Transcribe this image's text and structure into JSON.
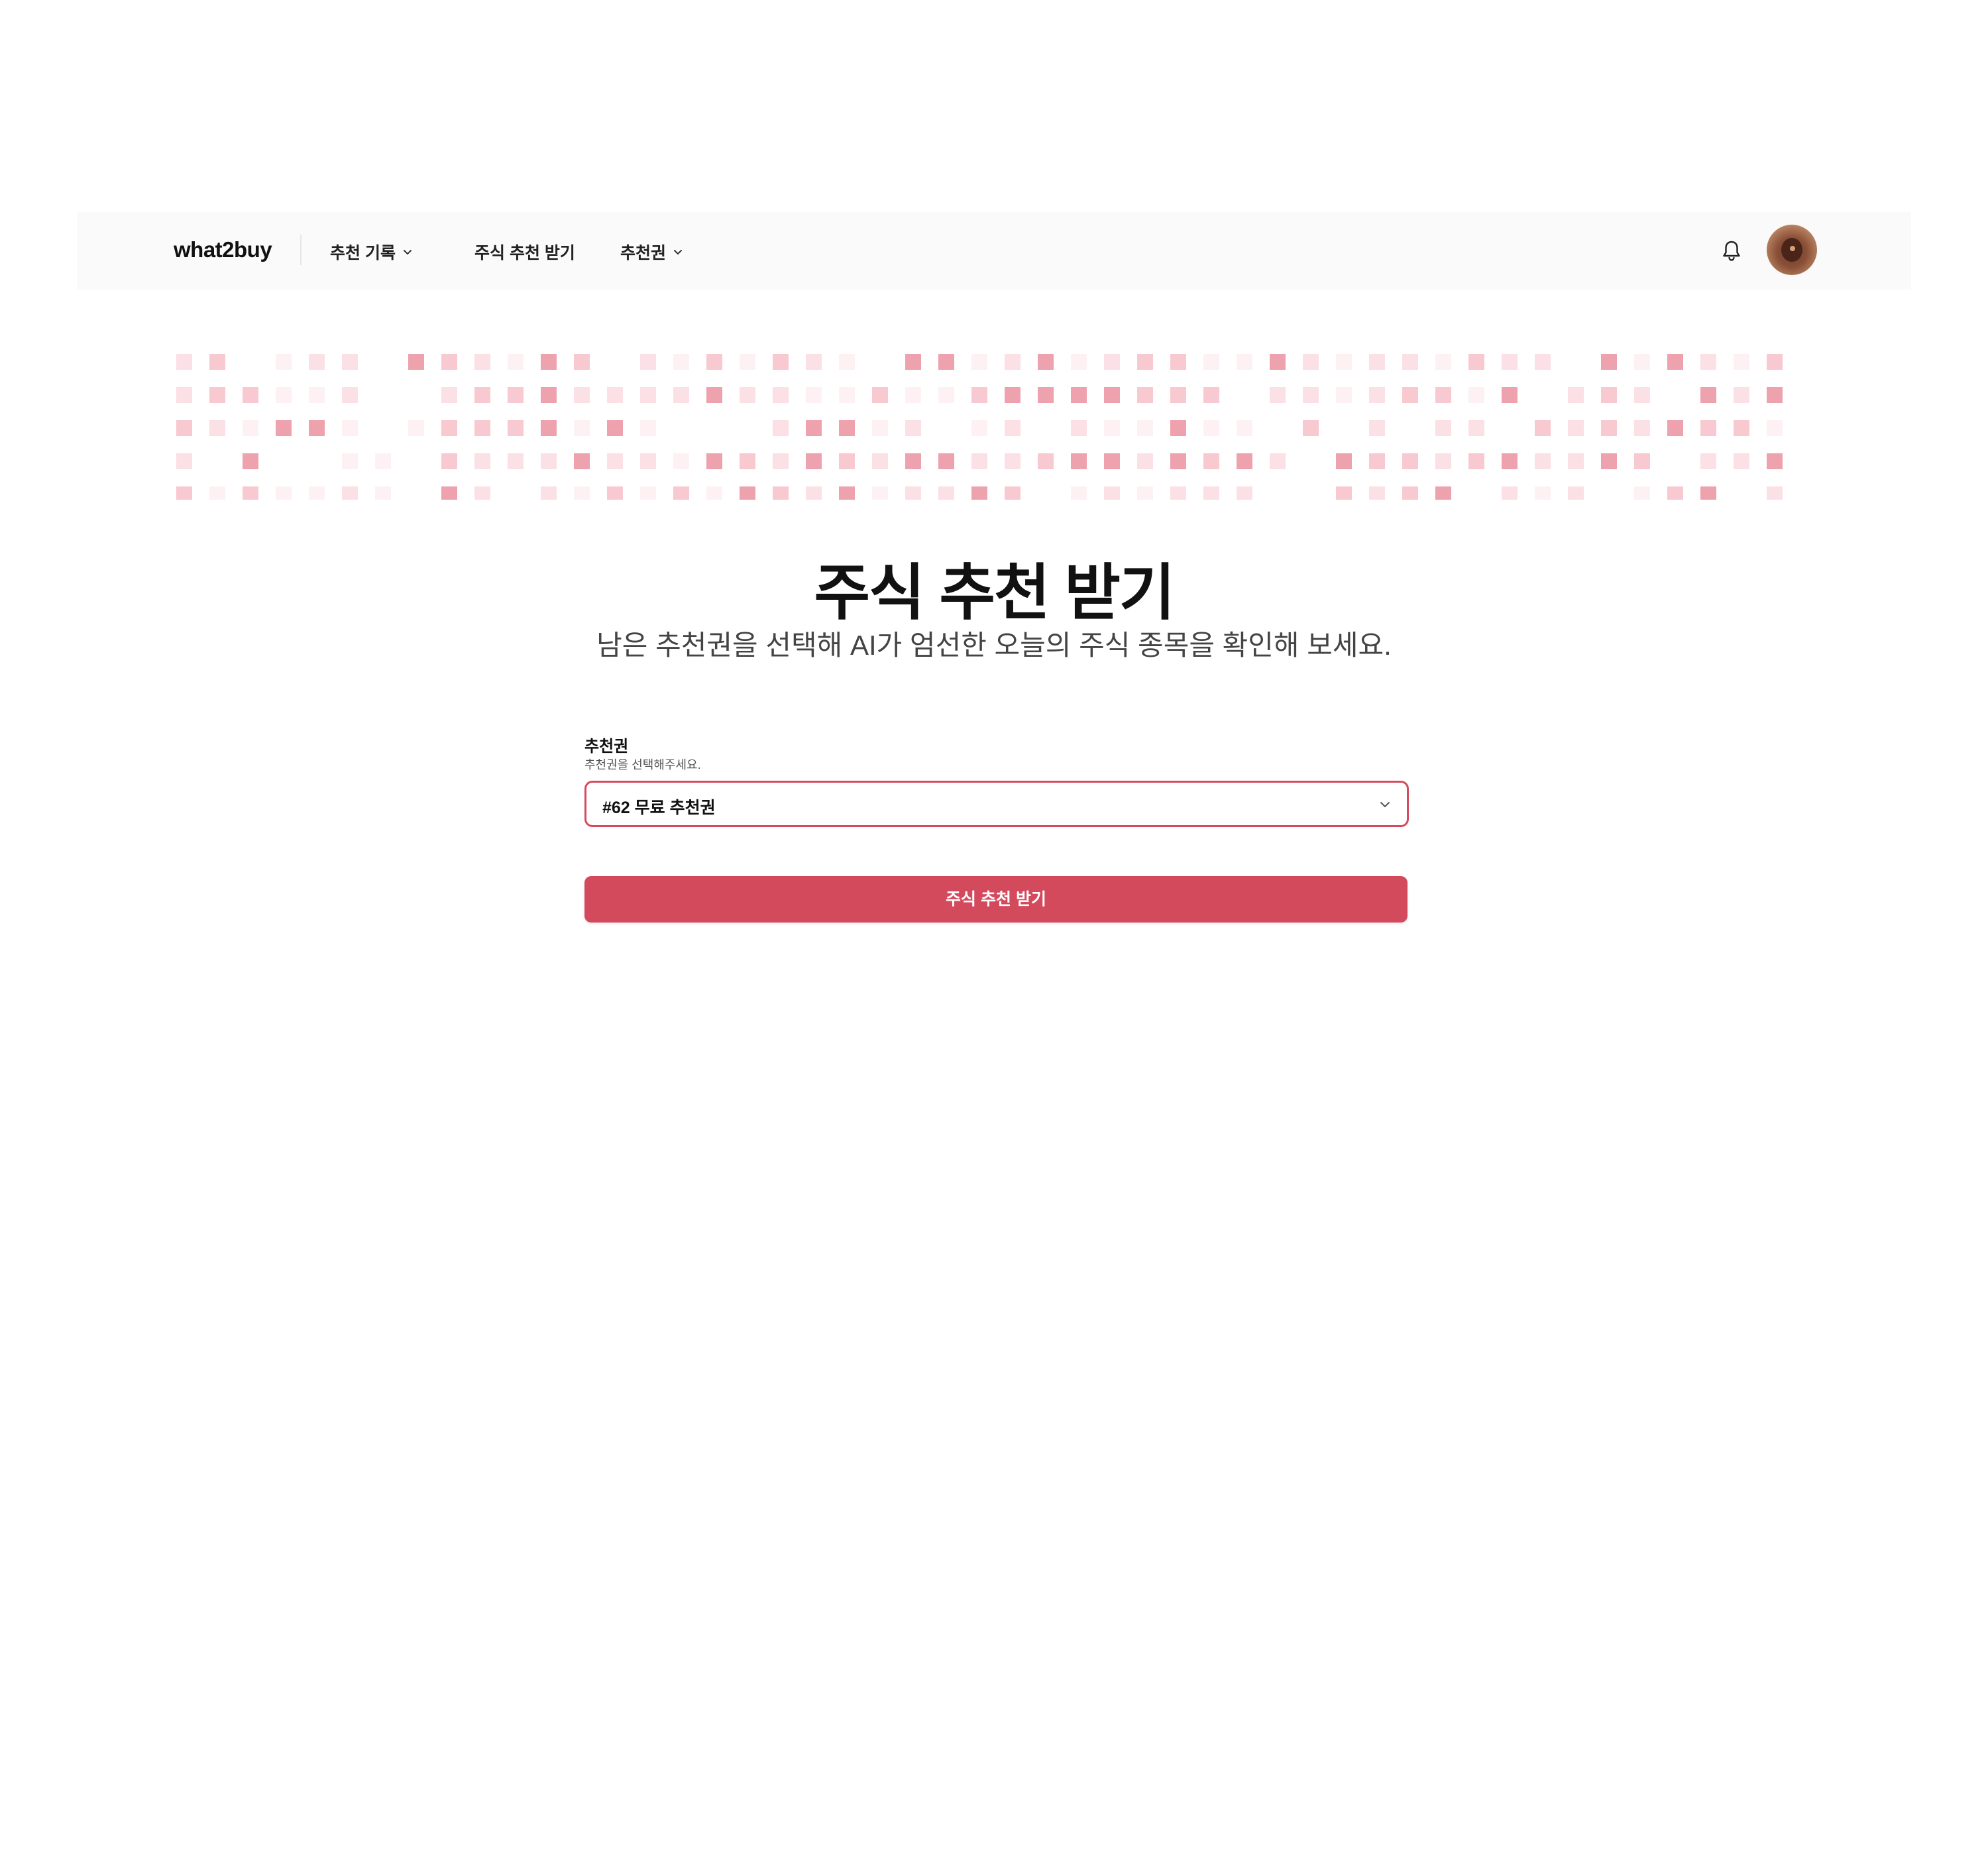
{
  "app": {
    "name": "what2buy"
  },
  "nav": {
    "items": [
      {
        "label": "추천 기록",
        "has_dropdown": true
      },
      {
        "label": "주식 추천 받기",
        "has_dropdown": false
      },
      {
        "label": "추천권",
        "has_dropdown": true
      }
    ],
    "icons": {
      "notifications": "bell-icon",
      "profile": "user-avatar"
    }
  },
  "hero": {
    "title": "주식 추천 받기",
    "subtitle": "남은 추천권을 선택해 AI가 엄선한 오늘의 주식 종목을 확인해 보세요."
  },
  "form": {
    "ticket_label": "추천권",
    "ticket_help": "추천권을 선택해주세요.",
    "ticket_selected": "#62 무료 추천권",
    "submit_label": "주식 추천 받기"
  },
  "colors": {
    "accent": "#d44a5d",
    "pattern_light": "#fde7ea",
    "pattern_mid": "#f8c9d0",
    "pattern_dark": "#eea2ad"
  }
}
